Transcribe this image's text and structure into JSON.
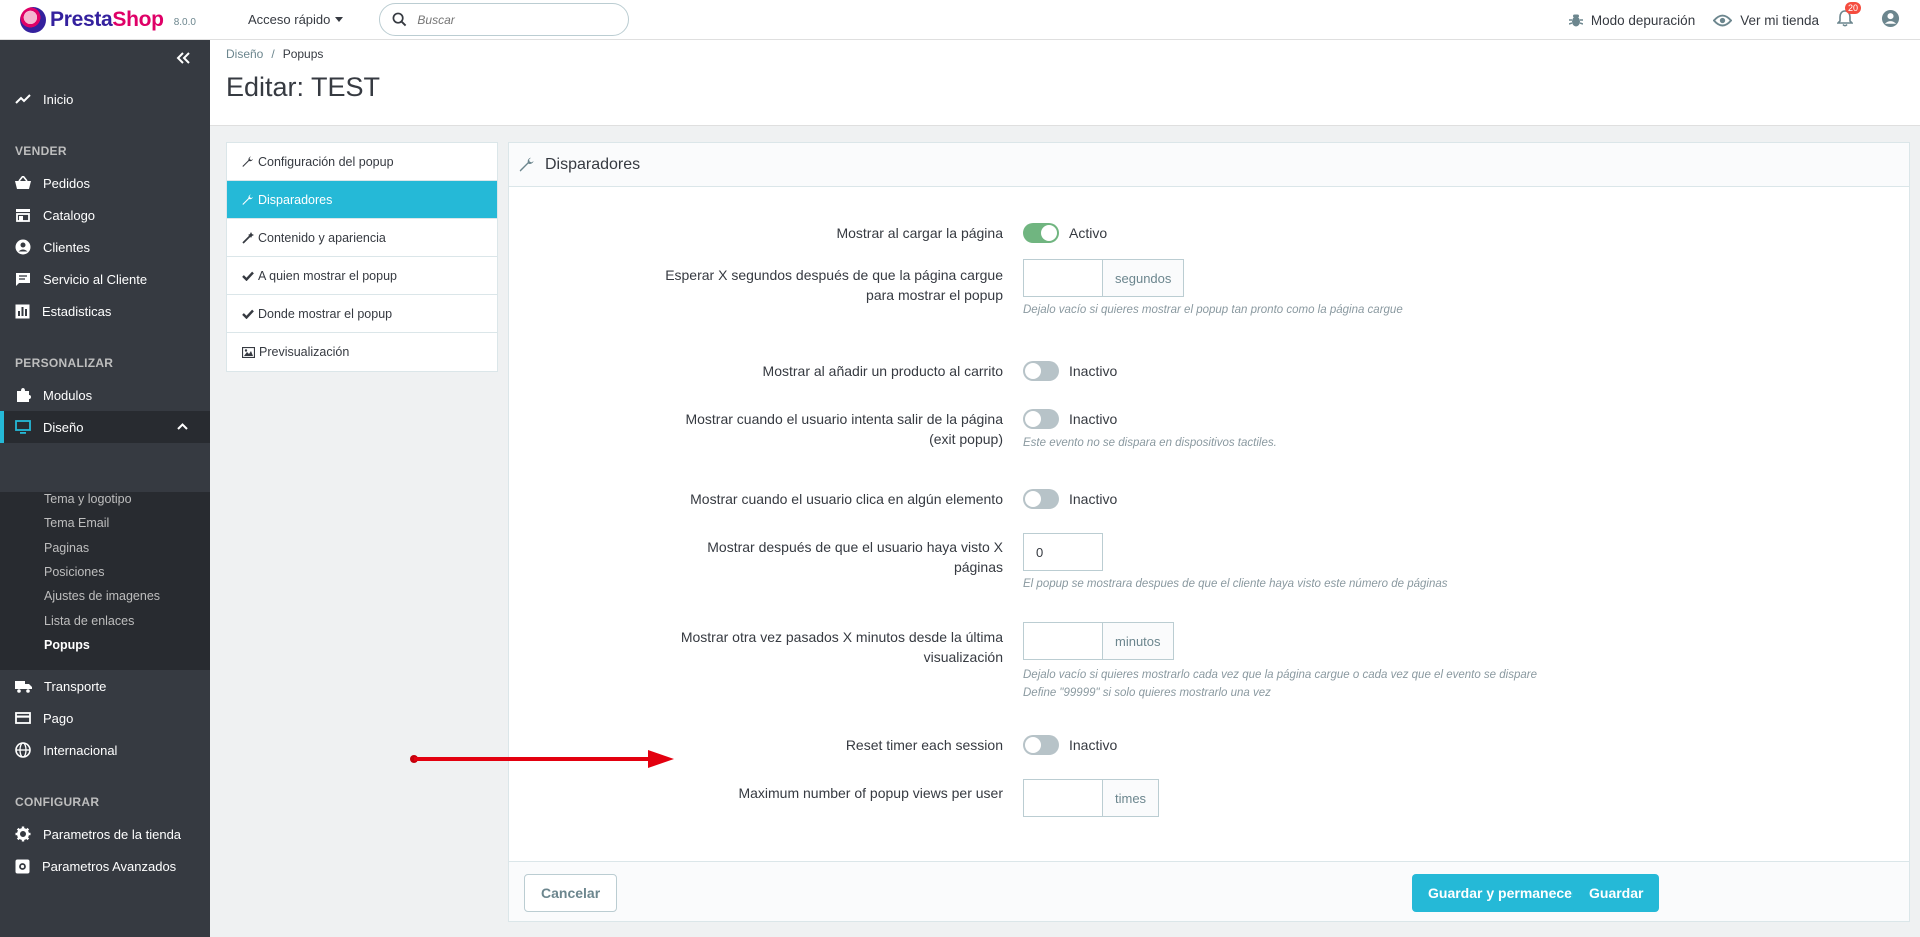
{
  "header": {
    "logo_text_a": "Presta",
    "logo_text_b": "Shop",
    "version": "8.0.0",
    "quick_access": "Acceso rápido",
    "search_placeholder": "Buscar",
    "debug_mode": "Modo depuración",
    "view_store": "Ver mi tienda",
    "notifications_count": "20"
  },
  "sidebar": {
    "home": "Inicio",
    "section_sell": "VENDER",
    "orders": "Pedidos",
    "catalog": "Catalogo",
    "customers": "Clientes",
    "customer_service": "Servicio al Cliente",
    "stats": "Estadisticas",
    "section_customize": "PERSONALIZAR",
    "modules": "Modulos",
    "design": "Diseño",
    "design_sub": [
      "Tema y logotipo",
      "Tema Email",
      "Paginas",
      "Posiciones",
      "Ajustes de imagenes",
      "Lista de enlaces",
      "Popups"
    ],
    "shipping": "Transporte",
    "payment": "Pago",
    "international": "Internacional",
    "section_configure": "CONFIGURAR",
    "shop_params": "Parametros de la tienda",
    "advanced_params": "Parametros Avanzados"
  },
  "breadcrumb": {
    "parent": "Diseño",
    "current": "Popups"
  },
  "page_title": "Editar: TEST",
  "tabs": [
    "Configuración del popup",
    "Disparadores",
    "Contenido y apariencia",
    "A quien mostrar el popup",
    "Donde mostrar el popup",
    "Previsualización"
  ],
  "panel": {
    "title": "Disparadores",
    "rows": {
      "on_load": {
        "label": "Mostrar al cargar la página",
        "state": "Activo"
      },
      "wait_seconds": {
        "label_1": "Esperar X segundos después de que la página cargue",
        "label_2": "para mostrar el popup",
        "addon": "segundos",
        "value": "",
        "help": "Dejalo vacío si quieres mostrar el popup tan pronto como la página cargue"
      },
      "add_to_cart": {
        "label": "Mostrar al añadir un producto al carrito",
        "state": "Inactivo"
      },
      "exit_popup": {
        "label_1": "Mostrar cuando el usuario intenta salir de la página",
        "label_2": "(exit popup)",
        "state": "Inactivo",
        "help": "Este evento no se dispara en dispositivos tactiles."
      },
      "on_click": {
        "label": "Mostrar cuando el usuario clica en algún elemento",
        "state": "Inactivo"
      },
      "after_pages": {
        "label_1": "Mostrar después de que el usuario haya visto X",
        "label_2": "páginas",
        "value": "0",
        "help": "El popup se mostrara despues de que el cliente haya visto este número de páginas"
      },
      "again_minutes": {
        "label_1": "Mostrar otra vez pasados X minutos desde la última",
        "label_2": "visualización",
        "addon": "minutos",
        "value": "",
        "help_1": "Dejalo vacío si quieres mostrarlo cada vez que la página cargue o cada vez que el evento se dispare",
        "help_2": "Define \"99999\" si solo quieres mostrarlo una vez"
      },
      "reset_timer": {
        "label": "Reset timer each session",
        "state": "Inactivo"
      },
      "max_views": {
        "label": "Maximum number of popup views per user",
        "addon": "times",
        "value": ""
      }
    },
    "cancel": "Cancelar",
    "save_stay": "Guardar y permanecer",
    "save": "Guardar"
  },
  "colors": {
    "accent": "#25b9d7",
    "sidebar": "#363a41",
    "switch_on": "#70b580",
    "arrow": "#e3000f"
  }
}
